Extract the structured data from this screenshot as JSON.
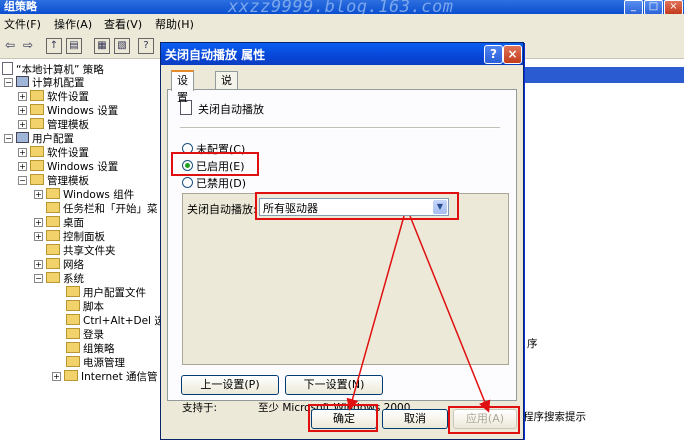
{
  "window": {
    "title": "组策略",
    "watermark": "xxzz9999.blog.163.com",
    "controls": [
      "_",
      "□",
      "×"
    ]
  },
  "menu": {
    "items": [
      "文件(F)",
      "操作(A)",
      "查看(V)",
      "帮助(H)"
    ]
  },
  "toolbar": {
    "icons": [
      "back-icon",
      "forward-icon",
      "up-folder-icon",
      "show-tree-icon",
      "properties-icon",
      "export-icon",
      "help-icon"
    ]
  },
  "tree": {
    "nodes": [
      "“本地计算机” 策略",
      "计算机配置",
      "软件设置",
      "Windows 设置",
      "管理模板",
      "用户配置",
      "软件设置",
      "Windows 设置",
      "管理模板",
      "Windows 组件",
      "任务栏和「开始」菜",
      "桌面",
      "控制面板",
      "共享文件夹",
      "网络",
      "系统",
      "用户配置文件",
      "脚本",
      "Ctrl+Alt+Del 选",
      "登录",
      "组策略",
      "电源管理",
      "Internet 通信管"
    ]
  },
  "right_pane": {
    "texts": [
      "序",
      "程序搜索提示"
    ]
  },
  "dialog": {
    "title": "关闭自动播放 属性",
    "help_button": "?",
    "close_button": "×",
    "tabs": [
      "设置",
      "说明"
    ],
    "policy_name": "关闭自动播放",
    "radios": [
      "未配置(C)",
      "已启用(E)",
      "已禁用(D)"
    ],
    "selected_radio": "已启用(E)",
    "option_label": "关闭自动播放:",
    "option_value": "所有驱动器",
    "combo_arrow": "▼",
    "supported_label": "支持于:",
    "supported_value": "至少 Microsoft Windows 2000",
    "prev_setting": "上一设置(P)",
    "next_setting": "下一设置(N)",
    "ok": "确定",
    "cancel": "取消",
    "apply": "应用(A)"
  },
  "colors": {
    "annotation": "#e01010",
    "title_blue": "#0a4fd0"
  }
}
